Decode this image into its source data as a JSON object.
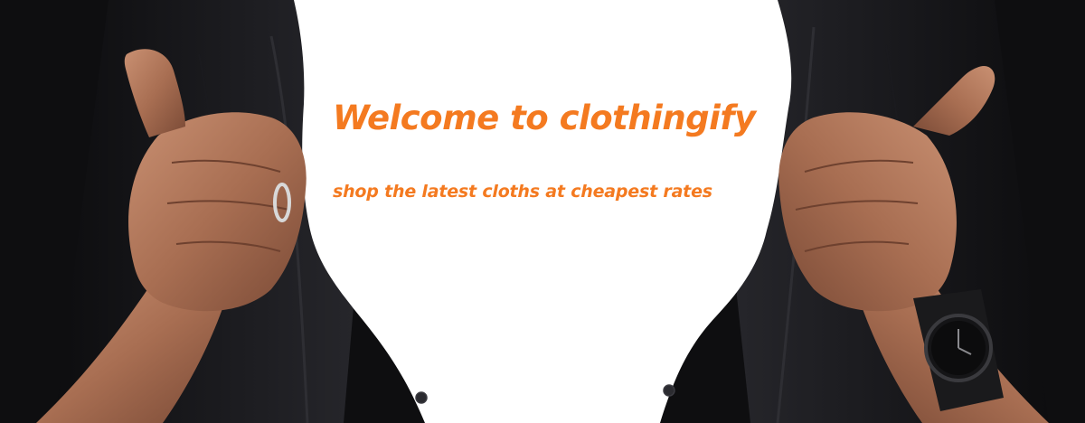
{
  "hero": {
    "headline": "Welcome to clothingify",
    "tagline": "shop the latest cloths at cheapest rates",
    "accent_color": "#f47a20",
    "background_color": "#0b0b0c",
    "reveal_color": "#ffffff"
  }
}
